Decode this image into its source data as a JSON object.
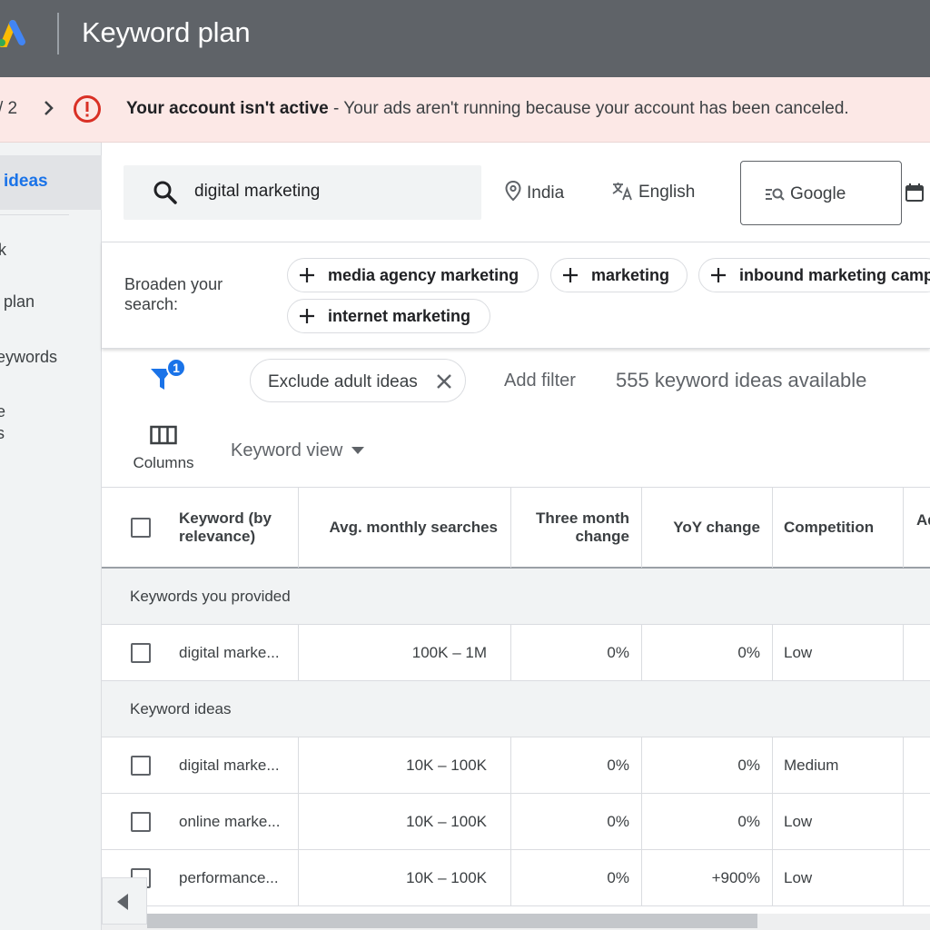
{
  "header": {
    "title": "Keyword plan"
  },
  "banner": {
    "crumb": "/ 2",
    "bold": "Your account isn't active",
    "message": " - Your ads aren't running because your account has been canceled."
  },
  "sidebar": {
    "active": "ideas",
    "items": [
      "k",
      "plan",
      "eywords",
      "e",
      "s"
    ]
  },
  "search": {
    "value": "digital marketing",
    "location": "India",
    "language": "English",
    "network": "Google"
  },
  "broaden": {
    "label": "Broaden your search:",
    "chips": [
      "media agency marketing",
      "marketing",
      "inbound marketing camp",
      "internet marketing"
    ]
  },
  "filters": {
    "badge": "1",
    "active_filter": "Exclude adult ideas",
    "add_filter": "Add filter",
    "available": "555 keyword ideas available"
  },
  "toolbar": {
    "columns": "Columns",
    "view": "Keyword view"
  },
  "table": {
    "headers": [
      "Keyword (by relevance)",
      "Avg. monthly searches",
      "Three month change",
      "YoY change",
      "Competition",
      "Ad"
    ],
    "group_provided": "Keywords you provided",
    "group_ideas": "Keyword ideas",
    "provided_rows": [
      {
        "keyword": "digital marke...",
        "searches": "100K – 1M",
        "three_month": "0%",
        "yoy": "0%",
        "competition": "Low"
      }
    ],
    "idea_rows": [
      {
        "keyword": "digital marke...",
        "searches": "10K – 100K",
        "three_month": "0%",
        "yoy": "0%",
        "competition": "Medium"
      },
      {
        "keyword": "online marke...",
        "searches": "10K – 100K",
        "three_month": "0%",
        "yoy": "0%",
        "competition": "Low"
      },
      {
        "keyword": "performance...",
        "searches": "10K – 100K",
        "three_month": "0%",
        "yoy": "+900%",
        "competition": "Low"
      }
    ]
  },
  "colors": {
    "topbar": "#5f6368",
    "banner": "#fce8e6",
    "alert": "#d93025",
    "accent": "#1a73e8"
  }
}
